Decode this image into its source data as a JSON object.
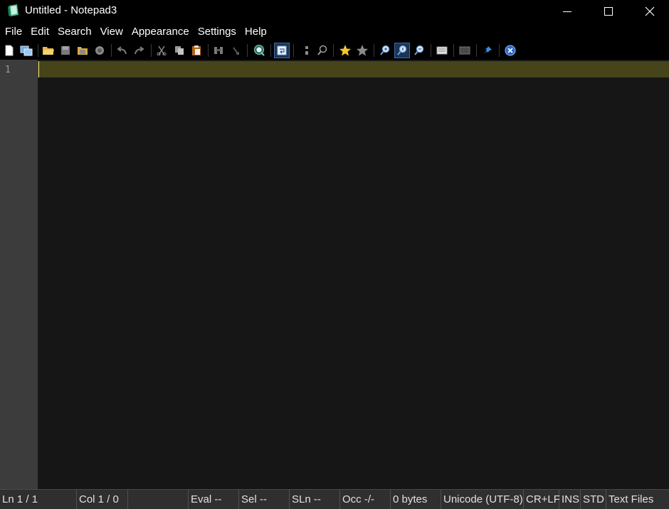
{
  "window": {
    "title": "Untitled - Notepad3",
    "minimize_icon": "minimize-icon",
    "maximize_icon": "maximize-icon",
    "close_icon": "close-icon"
  },
  "menu": [
    "File",
    "Edit",
    "Search",
    "View",
    "Appearance",
    "Settings",
    "Help"
  ],
  "toolbar": {
    "icons": [
      "new-file-icon",
      "new-window-icon",
      "open-folder-icon",
      "save-icon",
      "save-as-icon",
      "browse-icon",
      "undo-icon",
      "redo-icon",
      "cut-icon",
      "copy-icon",
      "paste-icon",
      "find-icon",
      "replace-icon",
      "find-in-files-icon",
      "word-wrap-icon",
      "goto-line-icon",
      "zoom-find-icon",
      "bookmark-icon",
      "favorites-icon",
      "zoom-in-icon",
      "zoom-reset-icon",
      "zoom-out-icon",
      "scheme-icon",
      "customize-icon",
      "pin-icon",
      "exit-icon"
    ]
  },
  "editor": {
    "line_numbers": [
      "1"
    ],
    "current_line_color": "#46441a",
    "background": "#161616"
  },
  "status": {
    "ln": "Ln  1 / 1",
    "col": "Col  1 / 0",
    "blank": "",
    "eval": "Eval  --",
    "sel": "Sel  --",
    "sln": "SLn  --",
    "occ": "Occ  -/-",
    "size": "0 bytes",
    "encoding": "Unicode (UTF-8)",
    "eol": "CR+LF",
    "ins": "INS",
    "std": "STD",
    "lexer": "Text Files"
  }
}
